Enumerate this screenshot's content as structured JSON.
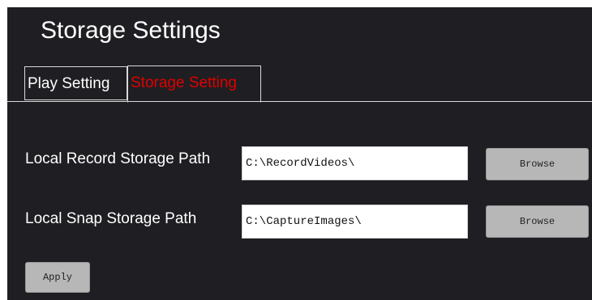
{
  "header": {
    "title": "Storage Settings"
  },
  "tabs": [
    {
      "label": "Play Setting"
    },
    {
      "label": "Storage Setting"
    }
  ],
  "form": {
    "record_path": {
      "label": "Local Record Storage Path",
      "value": "C:\\RecordVideos\\",
      "browse_label": "Browse"
    },
    "snap_path": {
      "label": "Local Snap Storage Path",
      "value": "C:\\CaptureImages\\",
      "browse_label": "Browse"
    },
    "apply_label": "Apply"
  },
  "colors": {
    "background": "#1f1e22",
    "active_tab_text": "#e00000",
    "text": "#ffffff",
    "button": "#b7b7b7"
  }
}
